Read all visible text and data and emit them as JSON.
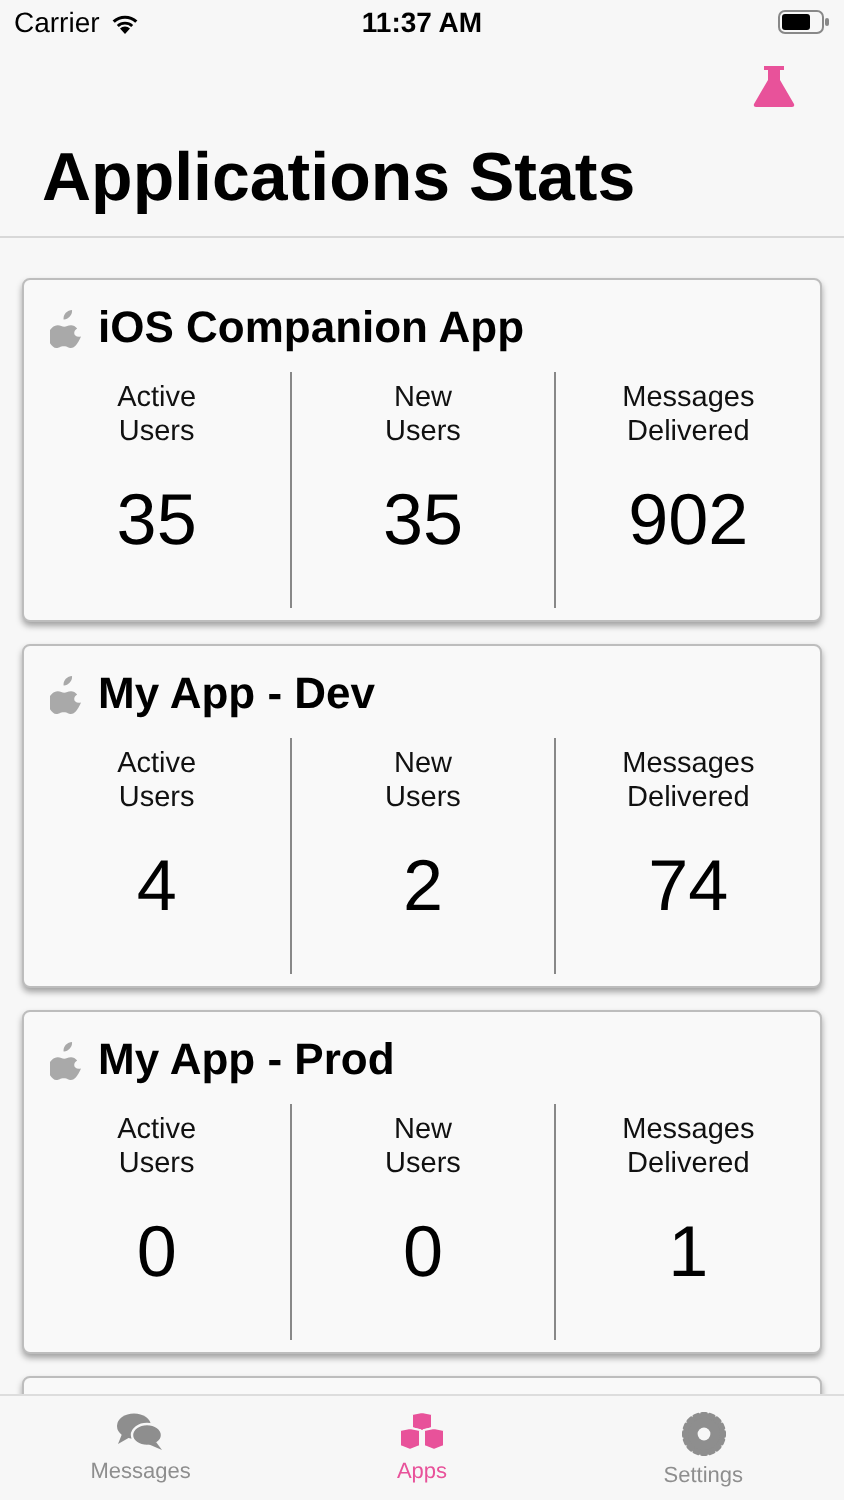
{
  "status_bar": {
    "carrier": "Carrier",
    "time": "11:37 AM"
  },
  "title": "Applications Stats",
  "apps": [
    {
      "name": "iOS Companion App",
      "stats": [
        {
          "label": "Active\nUsers",
          "value": "35"
        },
        {
          "label": "New\nUsers",
          "value": "35"
        },
        {
          "label": "Messages\nDelivered",
          "value": "902"
        }
      ]
    },
    {
      "name": "My App - Dev",
      "stats": [
        {
          "label": "Active\nUsers",
          "value": "4"
        },
        {
          "label": "New\nUsers",
          "value": "2"
        },
        {
          "label": "Messages\nDelivered",
          "value": "74"
        }
      ]
    },
    {
      "name": "My App - Prod",
      "stats": [
        {
          "label": "Active\nUsers",
          "value": "0"
        },
        {
          "label": "New\nUsers",
          "value": "0"
        },
        {
          "label": "Messages\nDelivered",
          "value": "1"
        }
      ]
    }
  ],
  "tabs": [
    {
      "label": "Messages",
      "kind": "messages",
      "selected": false
    },
    {
      "label": "Apps",
      "kind": "apps",
      "selected": true
    },
    {
      "label": "Settings",
      "kind": "settings",
      "selected": false
    }
  ]
}
